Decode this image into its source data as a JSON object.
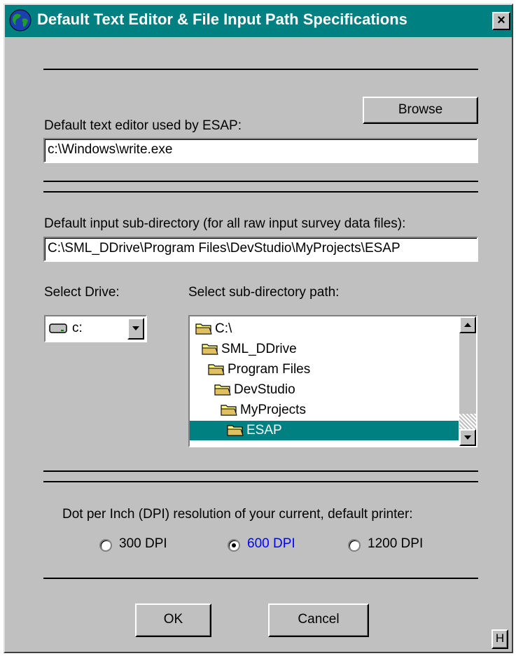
{
  "window": {
    "title": "Default Text Editor & File Input Path Specifications",
    "close_label": "×",
    "accent": "#008080"
  },
  "editor": {
    "browse_label": "Browse",
    "label": "Default text editor used by ESAP:",
    "value": "c:\\Windows\\write.exe"
  },
  "input_dir": {
    "label": "Default input sub-directory (for all raw input survey data files):",
    "value": "C:\\SML_DDrive\\Program Files\\DevStudio\\MyProjects\\ESAP"
  },
  "drive": {
    "label": "Select Drive:",
    "value": "c:",
    "icon": "drive-icon"
  },
  "dir_tree": {
    "label": "Select sub-directory path:",
    "items": [
      {
        "label": "C:\\",
        "level": 0,
        "selected": false
      },
      {
        "label": "SML_DDrive",
        "level": 1,
        "selected": false
      },
      {
        "label": "Program Files",
        "level": 2,
        "selected": false
      },
      {
        "label": "DevStudio",
        "level": 3,
        "selected": false
      },
      {
        "label": "MyProjects",
        "level": 4,
        "selected": false
      },
      {
        "label": "ESAP",
        "level": 5,
        "selected": true
      }
    ],
    "selected_color": "#008080"
  },
  "dpi": {
    "label": "Dot per Inch (DPI) resolution of your current, default printer:",
    "options": [
      {
        "label": "300 DPI",
        "checked": false
      },
      {
        "label": "600 DPI",
        "checked": true
      },
      {
        "label": "1200 DPI",
        "checked": false
      }
    ],
    "checked_color": "#0000ff"
  },
  "buttons": {
    "ok_label": "OK",
    "cancel_label": "Cancel",
    "help_label": "H"
  }
}
